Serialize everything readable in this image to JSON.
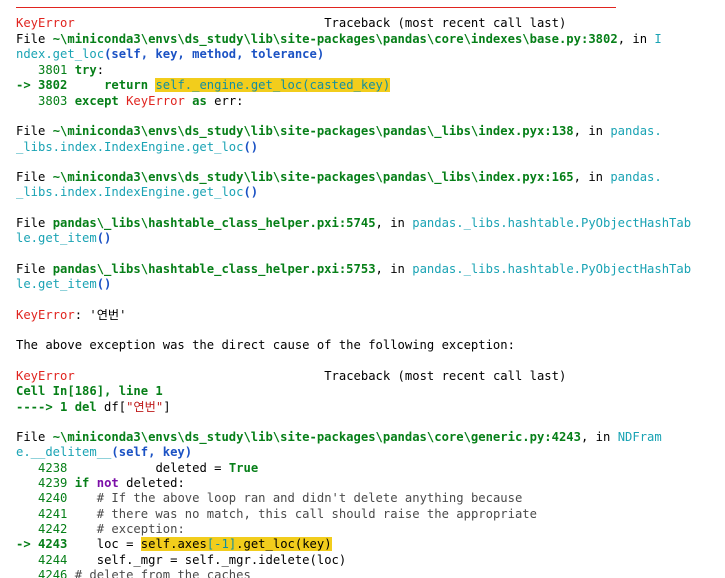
{
  "traceback": {
    "separator": "-------------------------------------------------------------------------------------",
    "error1": {
      "exc_name": "KeyError",
      "header_pad": "                                  ",
      "header_right": "Traceback (most recent call last)"
    },
    "frame1": {
      "prefix": "File ",
      "path": "~\\miniconda3\\envs\\ds_study\\lib\\site-packages\\pandas\\core\\indexes\\base.py:3802",
      "in_text": ", in ",
      "func_part1": "I",
      "func_part2": "ndex.get_loc",
      "func_args": "(self, key, method, tolerance)",
      "code": [
        {
          "lineno": "3801",
          "keyword": "try",
          "rest": ":"
        },
        {
          "arrow": "-> 3802",
          "keyword": "return ",
          "hl": "self._engine.get_loc(casted_key)"
        },
        {
          "lineno": "3803",
          "keyword": "except ",
          "exc": "KeyError",
          "kw2": " as ",
          "rest": "err:"
        }
      ]
    },
    "frame2": {
      "prefix": "File ",
      "path": "~\\miniconda3\\envs\\ds_study\\lib\\site-packages\\pandas\\_libs\\index.pyx:138",
      "in_text": ", in ",
      "func_part1": "pandas.",
      "func_part2": "_libs.index.IndexEngine.get_loc",
      "func_args": "()"
    },
    "frame3": {
      "prefix": "File ",
      "path": "~\\miniconda3\\envs\\ds_study\\lib\\site-packages\\pandas\\_libs\\index.pyx:165",
      "in_text": ", in ",
      "func_part1": "pandas.",
      "func_part2": "_libs.index.IndexEngine.get_loc",
      "func_args": "()"
    },
    "frame4": {
      "prefix": "File ",
      "path": "pandas\\_libs\\hashtable_class_helper.pxi:5745",
      "in_text": ", in ",
      "func_part1": "pandas._libs.hashtable.PyObjectHashTab",
      "func_part2": "le.get_item",
      "func_args": "()"
    },
    "frame5": {
      "prefix": "File ",
      "path": "pandas\\_libs\\hashtable_class_helper.pxi:5753",
      "in_text": ", in ",
      "func_part1": "pandas._libs.hashtable.PyObjectHashTab",
      "func_part2": "le.get_item",
      "func_args": "()"
    },
    "final_error1": {
      "exc_name": "KeyError",
      "message": ": '연번'"
    },
    "cause_text": "The above exception was the direct cause of the following exception:",
    "error2": {
      "exc_name": "KeyError",
      "header_pad": "                                  ",
      "header_right": "Traceback (most recent call last)"
    },
    "cell": {
      "text": "Cell In[186], line 1",
      "arrow": "----> 1 ",
      "keyword": "del",
      "code_pre": " df[",
      "code_str": "\"연번\"",
      "code_post": "]"
    },
    "frame6": {
      "prefix": "File ",
      "path": "~\\miniconda3\\envs\\ds_study\\lib\\site-packages\\pandas\\core\\generic.py:4243",
      "in_text": ", in ",
      "func_part1": "NDFram",
      "func_part2": "e.__delitem__",
      "func_args": "(self, key)",
      "code": [
        {
          "lineno": "4238",
          "indent": "            ",
          "text": "deleted = ",
          "kw": "True"
        },
        {
          "lineno": "4239",
          "kw": "if",
          "kwp": "not",
          "text": " deleted:"
        },
        {
          "lineno": "4240",
          "indent": "    ",
          "comment": "# If the above loop ran and didn't delete anything because"
        },
        {
          "lineno": "4241",
          "indent": "    ",
          "comment": "# there was no match, this call should raise the appropriate"
        },
        {
          "lineno": "4242",
          "indent": "    ",
          "comment": "# exception:"
        },
        {
          "arrow": "-> 4243",
          "indent": "    ",
          "pre": "loc = ",
          "hl_a": "self.axes",
          "hl_b": "[-1]",
          "hl_c": ".get_loc(key)"
        },
        {
          "lineno": "4244",
          "indent": "    ",
          "text": "self._mgr = self._mgr.idelete(loc)"
        },
        {
          "lineno": "4246",
          "comment": "# delete from the caches"
        }
      ]
    }
  }
}
